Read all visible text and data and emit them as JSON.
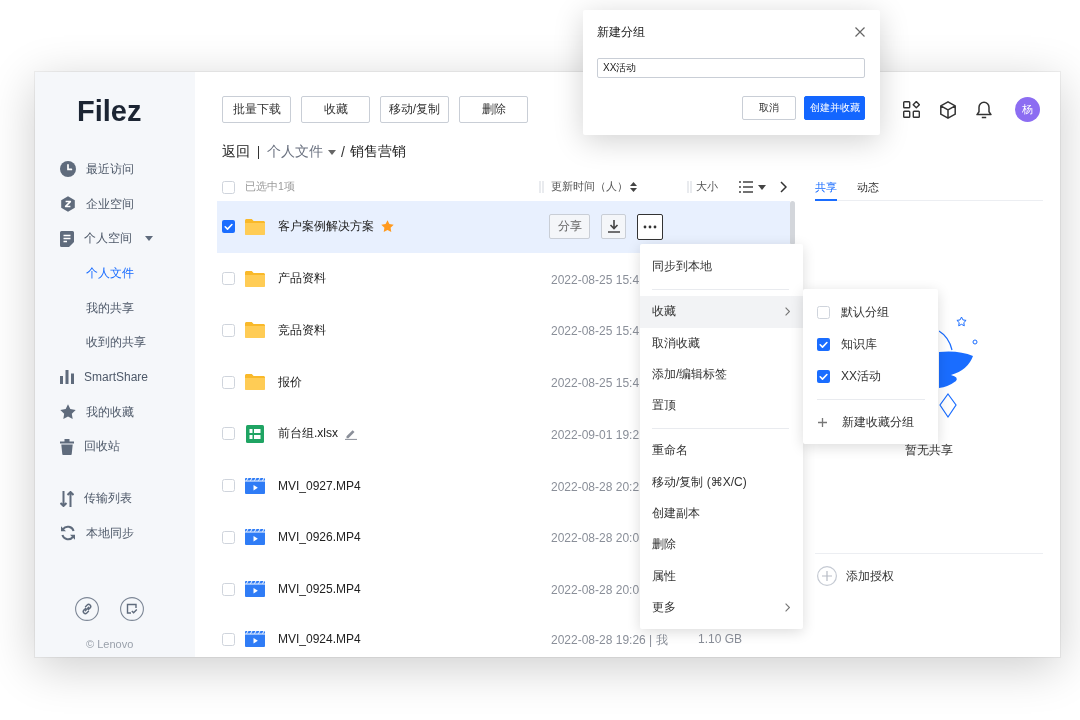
{
  "sidebar": {
    "logo": "Filez",
    "sections": [
      {
        "items": [
          {
            "label": "最近访问",
            "selected": false
          },
          {
            "label": "企业空间",
            "selected": false
          },
          {
            "label": "个人空间",
            "selected": false,
            "expanded": true,
            "children": [
              {
                "label": "个人文件",
                "selected": true
              },
              {
                "label": "我的共享",
                "selected": false
              },
              {
                "label": "收到的共享",
                "selected": false
              }
            ]
          },
          {
            "label": "SmartShare",
            "selected": false
          },
          {
            "label": "我的收藏",
            "selected": false
          },
          {
            "label": "回收站",
            "selected": false
          }
        ]
      },
      {
        "items": [
          {
            "label": "传输列表",
            "selected": false
          },
          {
            "label": "本地同步",
            "selected": false
          }
        ]
      }
    ],
    "footer": "© Lenovo"
  },
  "toolbar": {
    "buttons": [
      "批量下载",
      "收藏",
      "移动/复制",
      "删除"
    ],
    "avatar": "杨"
  },
  "breadcrumb": {
    "back": "返回",
    "separator": "/",
    "items": [
      {
        "label": "个人文件",
        "dropdown": true,
        "current": false
      },
      {
        "label": "销售营销",
        "dropdown": false,
        "current": true
      }
    ]
  },
  "file_list": {
    "select_all": {
      "checked": false
    },
    "selection_text": "已选中1项",
    "columns": [
      {
        "label": "更新时间（人）",
        "sortable": true
      },
      {
        "label": "大小",
        "sortable": false
      }
    ],
    "row_actions": {
      "share": "分享",
      "menu_open": true
    },
    "rows": [
      {
        "kind": "folder",
        "name": "客户案例解决方案",
        "starred": true,
        "editable": false,
        "checked": true,
        "selected": true
      },
      {
        "kind": "folder",
        "name": "产品资料",
        "date": "2022-08-25 15:4",
        "starred": false,
        "editable": false,
        "checked": false,
        "selected": false
      },
      {
        "kind": "folder",
        "name": "竞品资料",
        "date": "2022-08-25 15:4",
        "starred": false,
        "editable": false,
        "checked": false,
        "selected": false
      },
      {
        "kind": "folder",
        "name": "报价",
        "date": "2022-08-25 15:4",
        "starred": false,
        "editable": false,
        "checked": false,
        "selected": false
      },
      {
        "kind": "spreadsheet",
        "name": "前台组.xlsx",
        "date": "2022-09-01 19:2",
        "starred": false,
        "editable": true,
        "checked": false,
        "selected": false
      },
      {
        "kind": "video",
        "name": "MVI_0927.MP4",
        "date": "2022-08-28 20:2",
        "starred": false,
        "editable": false,
        "checked": false,
        "selected": false
      },
      {
        "kind": "video",
        "name": "MVI_0926.MP4",
        "date": "2022-08-28 20:0",
        "starred": false,
        "editable": false,
        "checked": false,
        "selected": false
      },
      {
        "kind": "video",
        "name": "MVI_0925.MP4",
        "date": "2022-08-28 20:0",
        "starred": false,
        "editable": false,
        "checked": false,
        "selected": false
      },
      {
        "kind": "video",
        "name": "MVI_0924.MP4",
        "date": "2022-08-28 19:26 | 我",
        "size": "1.10 GB",
        "starred": false,
        "editable": false,
        "checked": false,
        "selected": false
      }
    ]
  },
  "context_menu": {
    "groups": [
      {
        "items": [
          {
            "label": "同步到本地",
            "selected": false,
            "submenu": false
          }
        ]
      },
      {
        "items": [
          {
            "label": "收藏",
            "selected": true,
            "submenu": true
          },
          {
            "label": "取消收藏",
            "selected": false,
            "submenu": false
          },
          {
            "label": "添加/编辑标签",
            "selected": false,
            "submenu": false
          },
          {
            "label": "置顶",
            "selected": false,
            "submenu": false
          }
        ]
      },
      {
        "items": [
          {
            "label": "重命名",
            "selected": false,
            "submenu": false
          },
          {
            "label": "移动/复制 (⌘X/C)",
            "selected": false,
            "submenu": false
          },
          {
            "label": "创建副本",
            "selected": false,
            "submenu": false
          },
          {
            "label": "删除",
            "selected": false,
            "submenu": false
          },
          {
            "label": "属性",
            "selected": false,
            "submenu": false
          },
          {
            "label": "更多",
            "selected": false,
            "submenu": true
          }
        ]
      }
    ]
  },
  "favorites_submenu": {
    "items": [
      {
        "label": "默认分组",
        "checked": false
      },
      {
        "label": "知识库",
        "checked": true
      },
      {
        "label": "XX活动",
        "checked": true
      }
    ],
    "new_group": "新建收藏分组"
  },
  "side_panel": {
    "tabs": [
      {
        "label": "共享",
        "selected": true
      },
      {
        "label": "动态",
        "selected": false
      }
    ],
    "empty_text": "暂无共享",
    "add_button": "添加授权"
  },
  "dialog": {
    "title": "新建分组",
    "input": {
      "value": "XX活动"
    },
    "buttons": [
      {
        "label": "取消",
        "kind": "secondary"
      },
      {
        "label": "创建并收藏",
        "kind": "primary"
      }
    ]
  }
}
